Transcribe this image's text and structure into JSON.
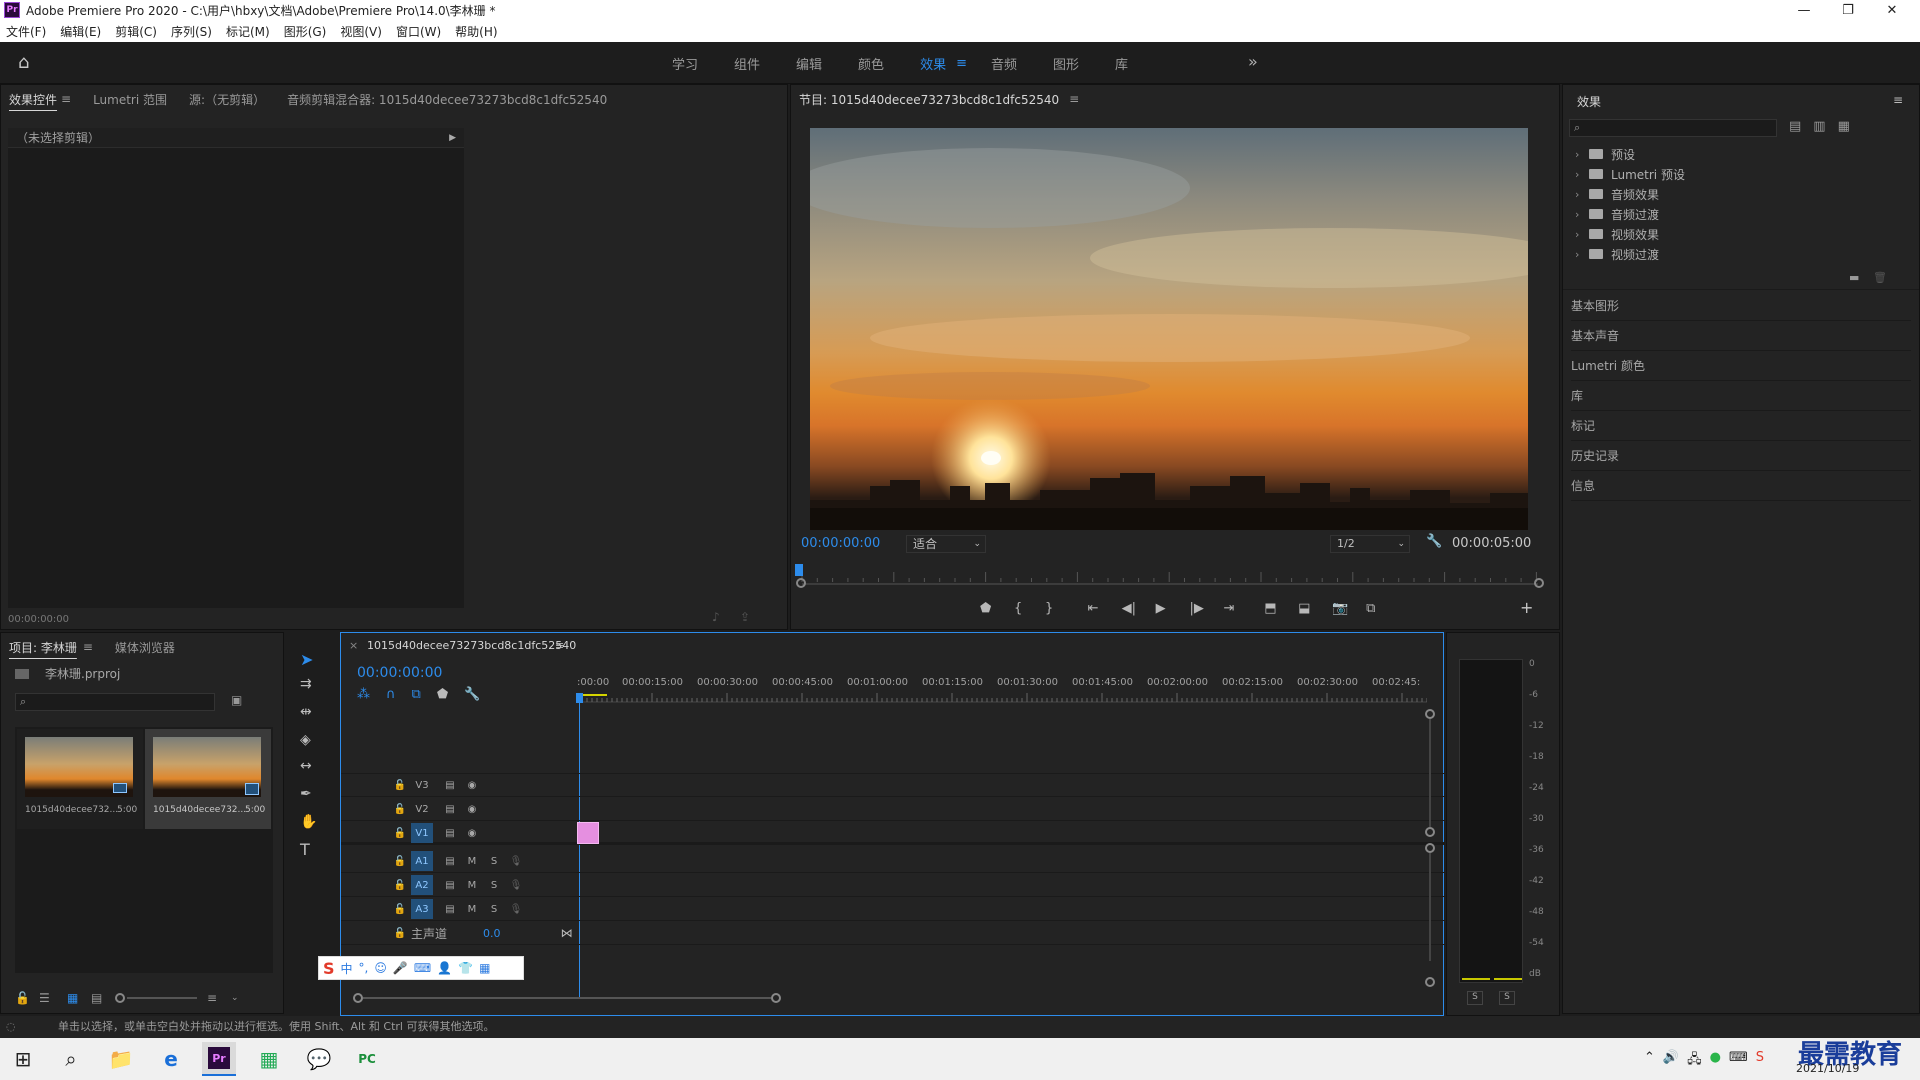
{
  "window": {
    "title": "Adobe Premiere Pro 2020 - C:\\用户\\hbxy\\文档\\Adobe\\Premiere Pro\\14.0\\李林珊 *",
    "app_icon": "Pr"
  },
  "menu": [
    "文件(F)",
    "编辑(E)",
    "剪辑(C)",
    "序列(S)",
    "标记(M)",
    "图形(G)",
    "视图(V)",
    "窗口(W)",
    "帮助(H)"
  ],
  "workspaces": [
    "学习",
    "组件",
    "编辑",
    "颜色",
    "效果",
    "音频",
    "图形",
    "库"
  ],
  "active_workspace": "效果",
  "effect_controls": {
    "tabs": [
      "效果控件",
      "Lumetri 范围",
      "源:（无剪辑）",
      "音频剪辑混合器: 1015d40decee73273bcd8c1dfc52540"
    ],
    "no_clip": "（未选择剪辑）",
    "timecode": "00:00:00:00"
  },
  "program": {
    "title": "节目: 1015d40decee73273bcd8c1dfc52540",
    "timecode": "00:00:00:00",
    "fit": "适合",
    "resolution": "1/2",
    "duration": "00:00:05:00"
  },
  "project": {
    "tabs": [
      "项目: 李林珊",
      "媒体浏览器"
    ],
    "file": "李林珊.prproj",
    "items": [
      {
        "name": "1015d40decee732...",
        "dur": "5:00"
      },
      {
        "name": "1015d40decee732...",
        "dur": "5:00"
      }
    ]
  },
  "timeline": {
    "seq_name": "1015d40decee73273bcd8c1dfc52540",
    "timecode": "00:00:00:00",
    "ruler": [
      ":00:00",
      "00:00:15:00",
      "00:00:30:00",
      "00:00:45:00",
      "00:01:00:00",
      "00:01:15:00",
      "00:01:30:00",
      "00:01:45:00",
      "00:02:00:00",
      "00:02:15:00",
      "00:02:30:00",
      "00:02:45:"
    ],
    "video_tracks": [
      "V3",
      "V2",
      "V1"
    ],
    "audio_tracks": [
      "A1",
      "A2",
      "A3"
    ],
    "master": "主声道",
    "master_val": "0.0",
    "m_label": "M",
    "s_label": "S"
  },
  "meter": {
    "scale": [
      "0",
      "-6",
      "-12",
      "-18",
      "-24",
      "-30",
      "-36",
      "-42",
      "-48",
      "-54",
      "dB"
    ],
    "solo": [
      "S",
      "S"
    ]
  },
  "effects": {
    "title": "效果",
    "tree": [
      "预设",
      "Lumetri 预设",
      "音频效果",
      "音频过渡",
      "视频效果",
      "视频过渡"
    ],
    "sections": [
      "基本图形",
      "基本声音",
      "Lumetri 颜色",
      "库",
      "标记",
      "历史记录",
      "信息"
    ]
  },
  "status_text": "单击以选择，或单击空白处并拖动以进行框选。使用 Shift、Alt 和 Ctrl 可获得其他选项。",
  "taskbar": {
    "date": "2021/10/19",
    "watermark": "最需教育"
  },
  "colors": {
    "accent": "#2d8ceb",
    "clip": "#e58fe0"
  }
}
